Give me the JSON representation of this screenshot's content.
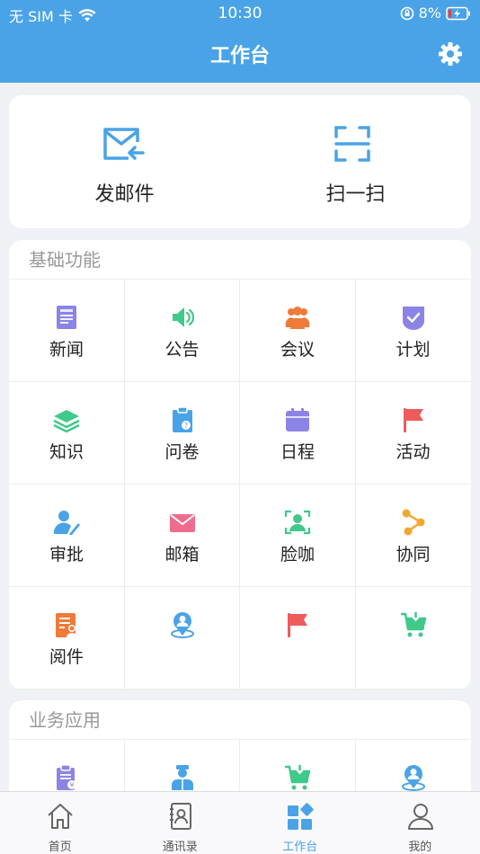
{
  "status": {
    "carrier": "无 SIM 卡",
    "time": "10:30",
    "battery": "8%"
  },
  "header": {
    "title": "工作台"
  },
  "quick": [
    {
      "label": "发邮件",
      "icon": "send-mail-icon"
    },
    {
      "label": "扫一扫",
      "icon": "scan-icon"
    }
  ],
  "basic": {
    "title": "基础功能",
    "items": [
      {
        "label": "新闻",
        "icon": "news-icon",
        "color": "#8b84e6"
      },
      {
        "label": "公告",
        "icon": "announcement-icon",
        "color": "#3fc98a"
      },
      {
        "label": "会议",
        "icon": "meeting-icon",
        "color": "#f07a3a"
      },
      {
        "label": "计划",
        "icon": "plan-icon",
        "color": "#8b84e6"
      },
      {
        "label": "知识",
        "icon": "knowledge-icon",
        "color": "#3fc98a"
      },
      {
        "label": "问卷",
        "icon": "questionnaire-icon",
        "color": "#4aa3e6"
      },
      {
        "label": "日程",
        "icon": "schedule-icon",
        "color": "#8b84e6"
      },
      {
        "label": "活动",
        "icon": "activity-flag-icon",
        "color": "#ee5b5b"
      },
      {
        "label": "审批",
        "icon": "approval-icon",
        "color": "#4aa3e6"
      },
      {
        "label": "邮箱",
        "icon": "mailbox-icon",
        "color": "#ee6c8e"
      },
      {
        "label": "脸咖",
        "icon": "face-icon",
        "color": "#3fc98a"
      },
      {
        "label": "协同",
        "icon": "collaboration-icon",
        "color": "#f0a830"
      },
      {
        "label": "阅件",
        "icon": "read-doc-icon",
        "color": "#f07a3a"
      },
      {
        "label": "",
        "icon": "location-person-icon",
        "color": "#4aa3e6"
      },
      {
        "label": "",
        "icon": "flag-icon",
        "color": "#ee5b5b"
      },
      {
        "label": "",
        "icon": "cart-download-icon",
        "color": "#3fc98a"
      }
    ]
  },
  "business": {
    "title": "业务应用",
    "items": [
      {
        "label": "",
        "icon": "expense-doc-icon",
        "color": "#8b84e6"
      },
      {
        "label": "",
        "icon": "staff-icon",
        "color": "#4aa3e6"
      },
      {
        "label": "",
        "icon": "cart-download-icon",
        "color": "#3fc98a"
      },
      {
        "label": "",
        "icon": "location-person-icon",
        "color": "#4aa3e6"
      }
    ]
  },
  "tabs": [
    {
      "label": "首页",
      "icon": "home-icon",
      "active": false
    },
    {
      "label": "通讯录",
      "icon": "contacts-icon",
      "active": false
    },
    {
      "label": "工作台",
      "icon": "workbench-icon",
      "active": true
    },
    {
      "label": "我的",
      "icon": "profile-icon",
      "active": false
    }
  ],
  "colors": {
    "primary": "#4aa3e6",
    "background": "#f0f1f5"
  }
}
